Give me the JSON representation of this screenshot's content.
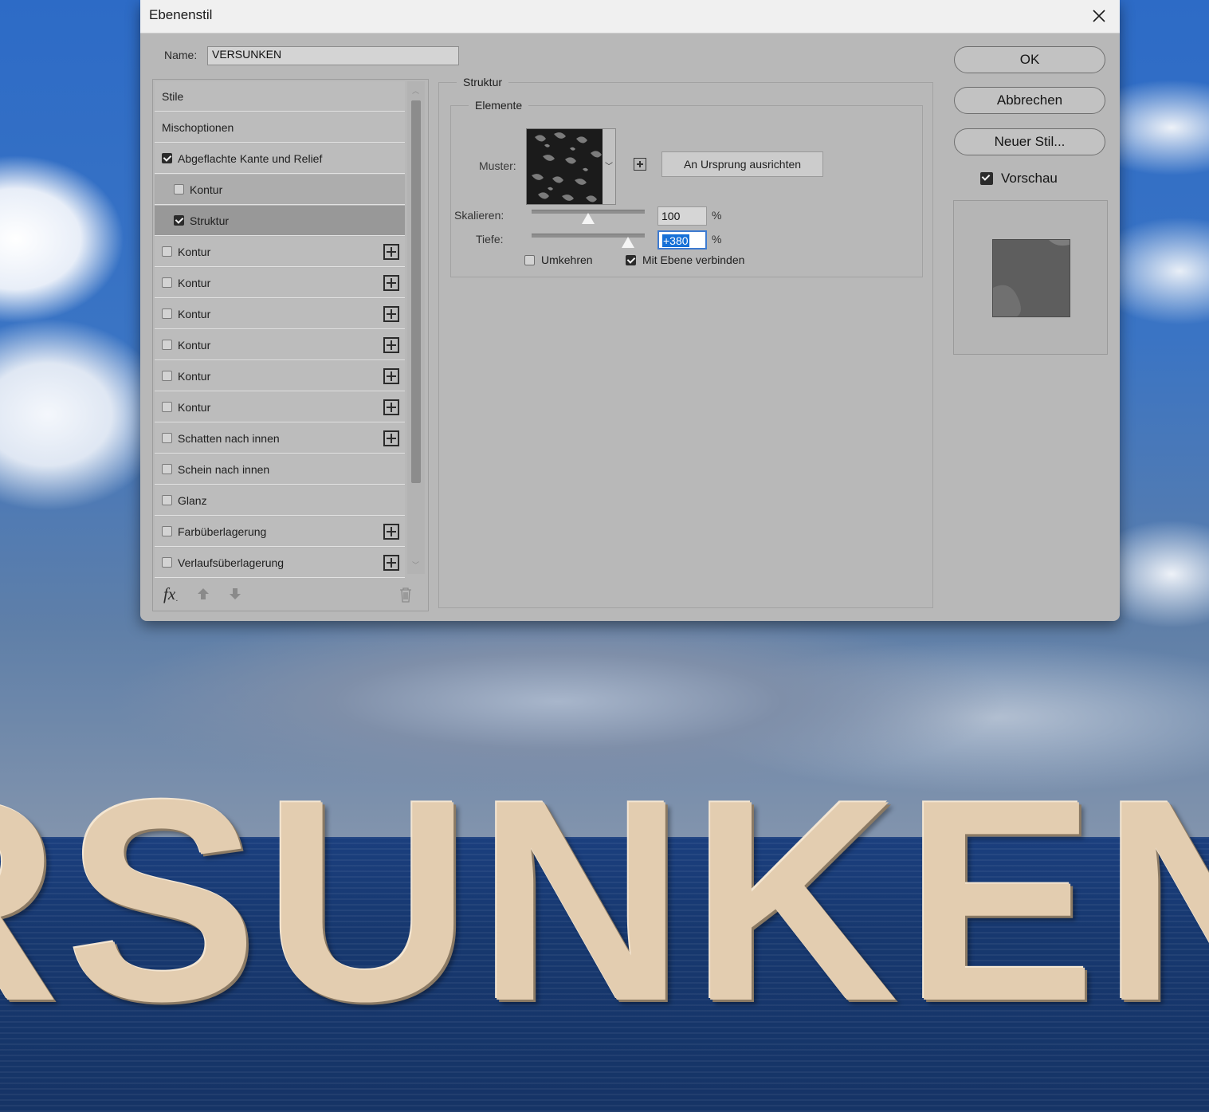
{
  "background": {
    "title_text": "RSUNKEN",
    "colors": {
      "sky": "#3a74c4",
      "sea": "#17386f",
      "letters": "#e3cdb0"
    }
  },
  "dialog": {
    "title": "Ebenenstil",
    "close_icon": "close-icon",
    "name_label": "Name:",
    "name_value": "VERSUNKEN"
  },
  "styles_list": {
    "items": [
      {
        "label": "Stile",
        "checkbox": false,
        "checked": false,
        "add_button": false,
        "level": 0,
        "selected": false
      },
      {
        "label": "Mischoptionen",
        "checkbox": false,
        "checked": false,
        "add_button": false,
        "level": 0,
        "selected": false
      },
      {
        "label": "Abgeflachte Kante und Relief",
        "checkbox": true,
        "checked": true,
        "add_button": false,
        "level": 0,
        "selected": false
      },
      {
        "label": "Kontur",
        "checkbox": true,
        "checked": false,
        "add_button": false,
        "level": 1,
        "selected": false
      },
      {
        "label": "Struktur",
        "checkbox": true,
        "checked": true,
        "add_button": false,
        "level": 1,
        "selected": true
      },
      {
        "label": "Kontur",
        "checkbox": true,
        "checked": false,
        "add_button": true,
        "level": 0,
        "selected": false
      },
      {
        "label": "Kontur",
        "checkbox": true,
        "checked": false,
        "add_button": true,
        "level": 0,
        "selected": false
      },
      {
        "label": "Kontur",
        "checkbox": true,
        "checked": false,
        "add_button": true,
        "level": 0,
        "selected": false
      },
      {
        "label": "Kontur",
        "checkbox": true,
        "checked": false,
        "add_button": true,
        "level": 0,
        "selected": false
      },
      {
        "label": "Kontur",
        "checkbox": true,
        "checked": false,
        "add_button": true,
        "level": 0,
        "selected": false
      },
      {
        "label": "Kontur",
        "checkbox": true,
        "checked": false,
        "add_button": true,
        "level": 0,
        "selected": false
      },
      {
        "label": "Schatten nach innen",
        "checkbox": true,
        "checked": false,
        "add_button": true,
        "level": 0,
        "selected": false
      },
      {
        "label": "Schein nach innen",
        "checkbox": true,
        "checked": false,
        "add_button": false,
        "level": 0,
        "selected": false
      },
      {
        "label": "Glanz",
        "checkbox": true,
        "checked": false,
        "add_button": false,
        "level": 0,
        "selected": false
      },
      {
        "label": "Farbüberlagerung",
        "checkbox": true,
        "checked": false,
        "add_button": true,
        "level": 0,
        "selected": false
      },
      {
        "label": "Verlaufsüberlagerung",
        "checkbox": true,
        "checked": false,
        "add_button": true,
        "level": 0,
        "selected": false
      }
    ],
    "footer": {
      "fx_label": "fx",
      "fx_sub": "˯",
      "icons": [
        "arrow-up-icon",
        "arrow-down-icon",
        "trash-icon"
      ]
    }
  },
  "structure": {
    "title": "Struktur",
    "elements_title": "Elemente",
    "pattern_label": "Muster:",
    "snap_button": "An Ursprung ausrichten",
    "scale_label": "Skalieren:",
    "scale_value": "100",
    "scale_fraction": 0.5,
    "depth_label": "Tiefe:",
    "depth_value": "+380",
    "depth_fraction": 0.85,
    "percent": "%",
    "invert_label": "Umkehren",
    "invert_checked": false,
    "link_label": "Mit Ebene verbinden",
    "link_checked": true
  },
  "buttons": {
    "ok": "OK",
    "cancel": "Abbrechen",
    "new_style": "Neuer Stil...",
    "preview_label": "Vorschau",
    "preview_checked": true
  }
}
